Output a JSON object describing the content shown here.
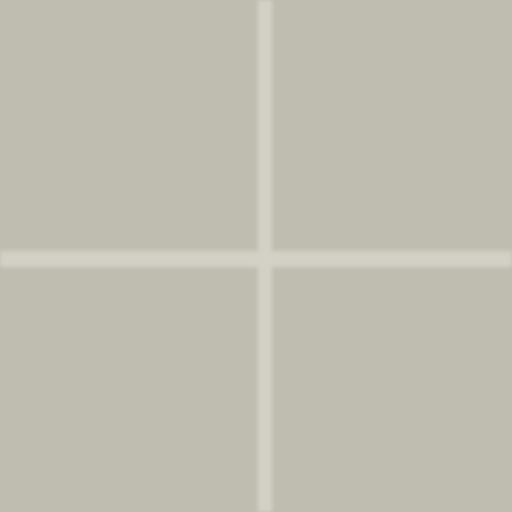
{
  "surface": {
    "type": "tile-grid",
    "rows": 2,
    "columns": 2,
    "tile_color": "#bfbdb0",
    "grout_color": "#d3d1c6"
  }
}
